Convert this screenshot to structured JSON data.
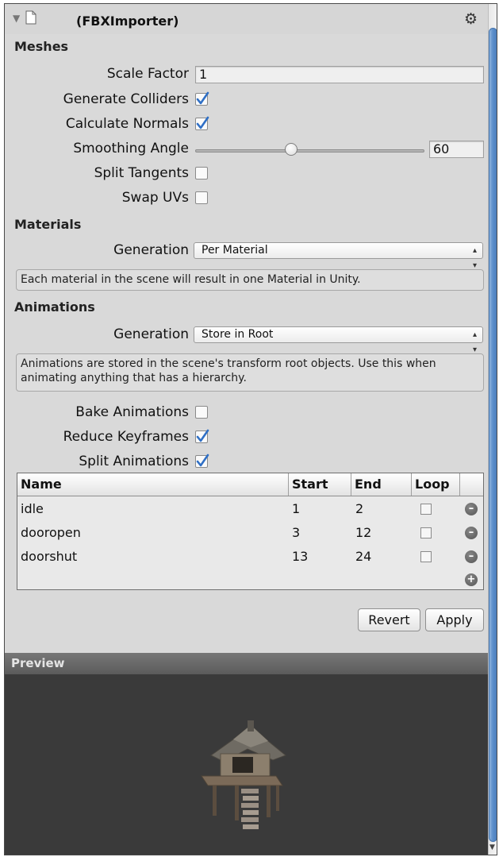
{
  "header": {
    "title": "(FBXImporter)"
  },
  "meshes": {
    "heading": "Meshes",
    "scale_factor": {
      "label": "Scale Factor",
      "value": "1"
    },
    "generate_colliders": {
      "label": "Generate Colliders",
      "checked": true
    },
    "calculate_normals": {
      "label": "Calculate Normals",
      "checked": true
    },
    "smoothing_angle": {
      "label": "Smoothing Angle",
      "value": "60",
      "level": 0.42
    },
    "split_tangents": {
      "label": "Split Tangents",
      "checked": false
    },
    "swap_uvs": {
      "label": "Swap UVs",
      "checked": false
    }
  },
  "materials": {
    "heading": "Materials",
    "generation_label": "Generation",
    "generation_value": "Per Material",
    "help": "Each material in the scene will result in one Material in Unity."
  },
  "animations": {
    "heading": "Animations",
    "generation_label": "Generation",
    "generation_value": "Store in Root",
    "help": "Animations are stored in the scene's transform root objects. Use this when animating anything that has a hierarchy.",
    "bake_animations": {
      "label": "Bake Animations",
      "checked": false
    },
    "reduce_keyframes": {
      "label": "Reduce Keyframes",
      "checked": true
    },
    "split_animations": {
      "label": "Split Animations",
      "checked": true
    }
  },
  "clips": {
    "headers": {
      "name": "Name",
      "start": "Start",
      "end": "End",
      "loop": "Loop"
    },
    "rows": [
      {
        "name": "idle",
        "start": "1",
        "end": "2",
        "loop": false
      },
      {
        "name": "dooropen",
        "start": "3",
        "end": "12",
        "loop": false
      },
      {
        "name": "doorshut",
        "start": "13",
        "end": "24",
        "loop": false
      }
    ]
  },
  "buttons": {
    "revert": "Revert",
    "apply": "Apply"
  },
  "preview": {
    "label": "Preview"
  },
  "icons": {
    "fold": "triangle-down-icon",
    "asset": "document-icon",
    "settings": "gear-icon",
    "remove": "minus-circle-icon",
    "add": "plus-circle-icon"
  },
  "colors": {
    "accent": "#2f6fc5",
    "preview_bg": "#3a3a3a",
    "scrollbar": "#5d8fcb"
  }
}
